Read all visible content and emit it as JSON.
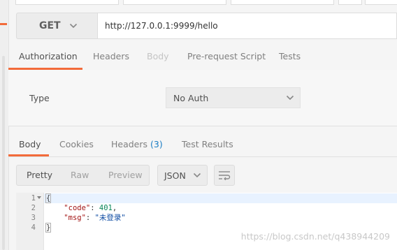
{
  "request": {
    "method": "GET",
    "url": "http://127.0.0.1:9999/hello"
  },
  "request_tabs": [
    {
      "label": "Authorization",
      "state": "active"
    },
    {
      "label": "Headers",
      "state": "normal"
    },
    {
      "label": "Body",
      "state": "disabled"
    },
    {
      "label": "Pre-request Script",
      "state": "normal"
    },
    {
      "label": "Tests",
      "state": "normal"
    }
  ],
  "auth": {
    "type_label": "Type",
    "type_value": "No Auth"
  },
  "response_tabs": [
    {
      "label": "Body",
      "state": "active"
    },
    {
      "label": "Cookies",
      "state": "normal"
    },
    {
      "label": "Headers",
      "count": "(3)",
      "state": "normal"
    },
    {
      "label": "Test Results",
      "state": "normal"
    }
  ],
  "view_modes": [
    {
      "label": "Pretty",
      "state": "active"
    },
    {
      "label": "Raw",
      "state": "normal"
    },
    {
      "label": "Preview",
      "state": "normal"
    }
  ],
  "format": "JSON",
  "icons": {
    "method_dropdown": "chevron-down-icon",
    "auth_dropdown": "chevron-down-icon",
    "format_dropdown": "chevron-down-icon",
    "wrap": "wrap-lines-icon",
    "fold": "fold-arrow-icon"
  },
  "response_body": {
    "line_numbers": [
      "1",
      "2",
      "3",
      "4"
    ],
    "lines": [
      "{",
      "    \"code\": 401,",
      "    \"msg\": \"未登录\"",
      "}"
    ],
    "code_key": "\"code\"",
    "code_value": "401",
    "msg_key": "\"msg\"",
    "msg_value": "\"未登录\""
  },
  "watermark": "https://blog.csdn.net/q438944209",
  "colors": {
    "accent": "#f26b3a",
    "count_blue": "#1a7dc4"
  }
}
